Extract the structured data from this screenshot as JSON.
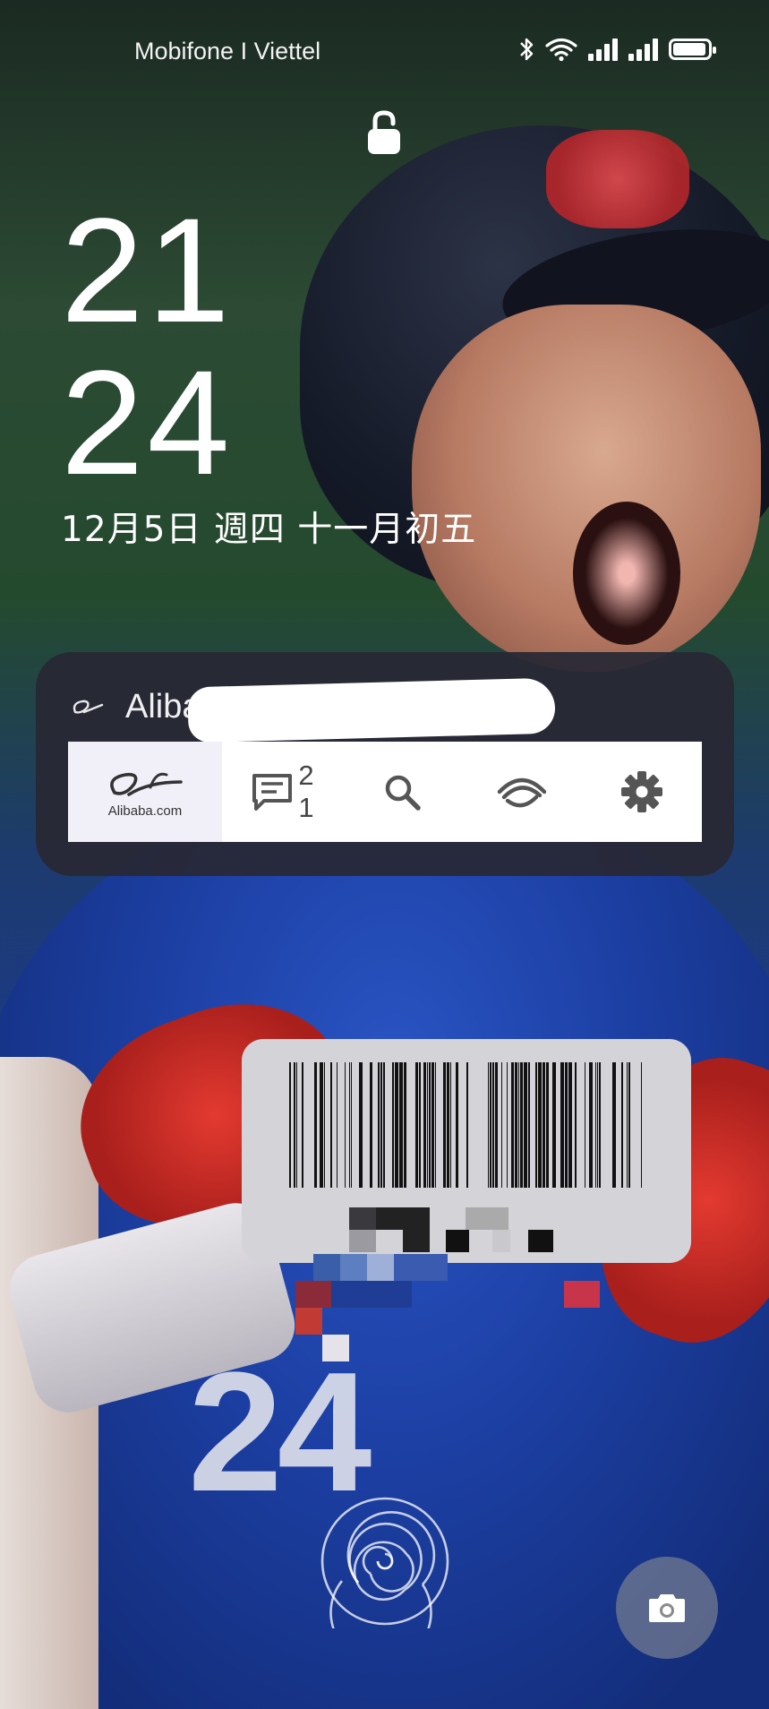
{
  "status_bar": {
    "carrier": "Mobifone I Viettel",
    "icons": [
      "bluetooth-icon",
      "wifi-icon",
      "signal-icon",
      "signal-icon",
      "battery-icon"
    ],
    "battery_level": 0.95
  },
  "lock": {
    "icon": "unlocked-padlock-icon"
  },
  "clock": {
    "hours": "21",
    "minutes": "24",
    "date": "12月5日 週四 十一月初五"
  },
  "notification": {
    "app_name": "Aliba",
    "app_icon": "alibaba-logo-icon",
    "widget": {
      "home_logo_text": "Alibaba.com",
      "messages": {
        "icon": "message-icon",
        "count_line1": "2",
        "count_line2": "1"
      },
      "search_icon": "search-icon",
      "scan_icon": "eye-scan-icon",
      "settings_icon": "gear-icon"
    }
  },
  "barcode": {
    "icon": "barcode-icon"
  },
  "bottom": {
    "fingerprint_icon": "fingerprint-icon",
    "camera_icon": "camera-icon"
  },
  "wallpaper": {
    "jersey_number": "24"
  },
  "colors": {
    "notification_bg": "#28283400",
    "widget_bg": "#ffffff",
    "icon_gray": "#555555"
  }
}
